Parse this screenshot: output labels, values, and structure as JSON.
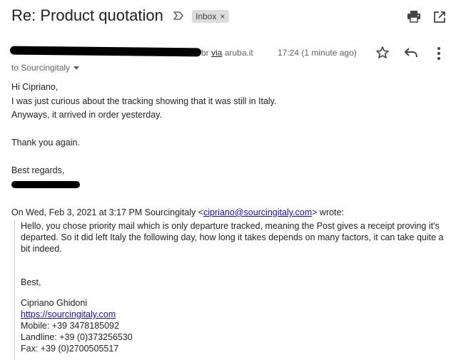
{
  "header": {
    "subject": "Re: Product quotation",
    "label_chip": "Inbox",
    "label_remove": "×"
  },
  "icons": {
    "label": "label-important-icon",
    "print": "print-icon",
    "popout": "open-in-new-window-icon",
    "star": "star-icon",
    "reply": "reply-icon",
    "more": "more-vertical-icon",
    "caret": "chevron-down-icon"
  },
  "message": {
    "sender_tail": "br",
    "via_word": "via",
    "via_domain": "aruba.it",
    "timestamp": "17:24 (1 minute ago)",
    "to_line": "to Sourcingitaly",
    "body": [
      "Hi Cipriano,",
      "I was just curious about the tracking showing that it was still in Italy.",
      "Anyways, it arrived in order yesterday.",
      "Thank you again.",
      "Best regards,"
    ]
  },
  "quote": {
    "header_prefix": "On Wed, Feb 3, 2021 at 3:17 PM Sourcingitaly <",
    "header_email": "cipriano@sourcingitaly.com",
    "header_suffix": "> wrote:",
    "paragraph": "Hello, you chose priority mail which is only departure tracked, meaning the Post gives a receipt proving it's departed. So it did left Italy the following day, how long it takes depends on many factors, it can take quite a bit indeed.",
    "closing": "Best,",
    "name": "Cipriano Ghidoni",
    "website": "https://sourcingitaly.com",
    "mobile": "Mobile: +39 3478185092",
    "landline": "Landline: +39 (0)373256530",
    "fax": "Fax: +39 (0)2700505517"
  },
  "colors": {
    "link": "#1a0dab",
    "chip_bg": "#dddddd",
    "muted_text": "#5f6368"
  }
}
